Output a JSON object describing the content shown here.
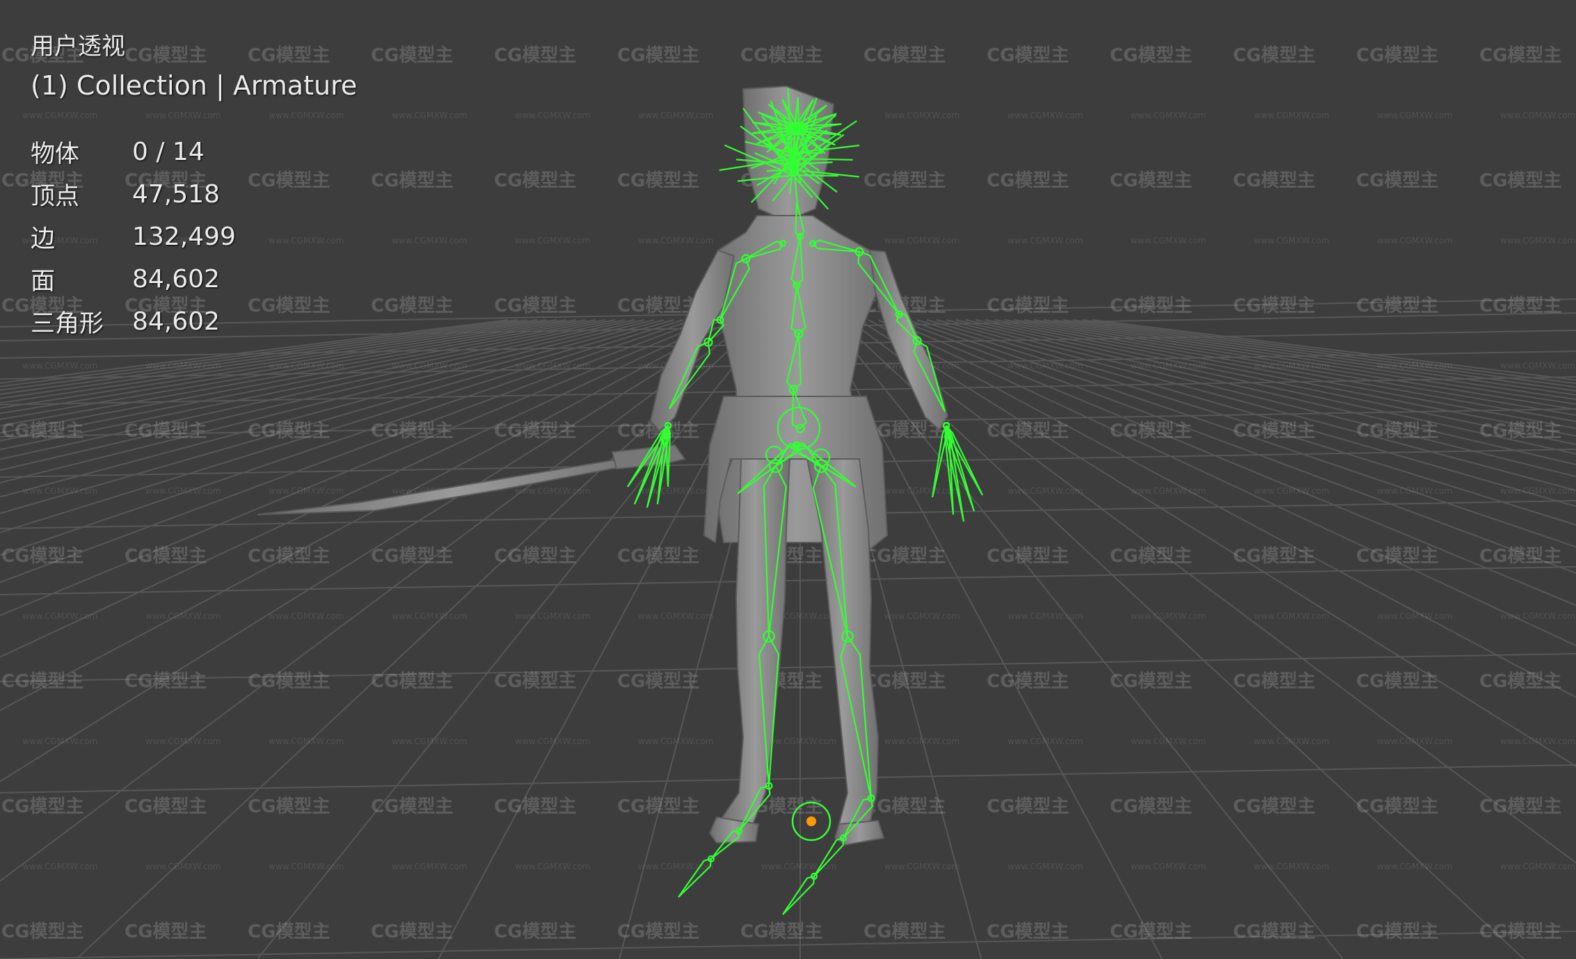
{
  "viewport": {
    "view_name": "用户透视",
    "context_line": "(1) Collection | Armature",
    "stats": [
      {
        "label": "物体",
        "value": "0 / 14"
      },
      {
        "label": "顶点",
        "value": "47,518"
      },
      {
        "label": "边",
        "value": "132,499"
      },
      {
        "label": "面",
        "value": "84,602"
      },
      {
        "label": "三角形",
        "value": "84,602"
      }
    ]
  },
  "watermark": {
    "logo_text": "CG模型主",
    "url_text": "www.CGMXW.com"
  },
  "colors": {
    "background": "#3d3d3d",
    "grid": "#5a5a5a",
    "armature": "#33ff33",
    "mesh": "#8a8a8a",
    "origin": "#ff9900"
  },
  "icons": [
    "armature-bones",
    "object-origin-dot"
  ]
}
